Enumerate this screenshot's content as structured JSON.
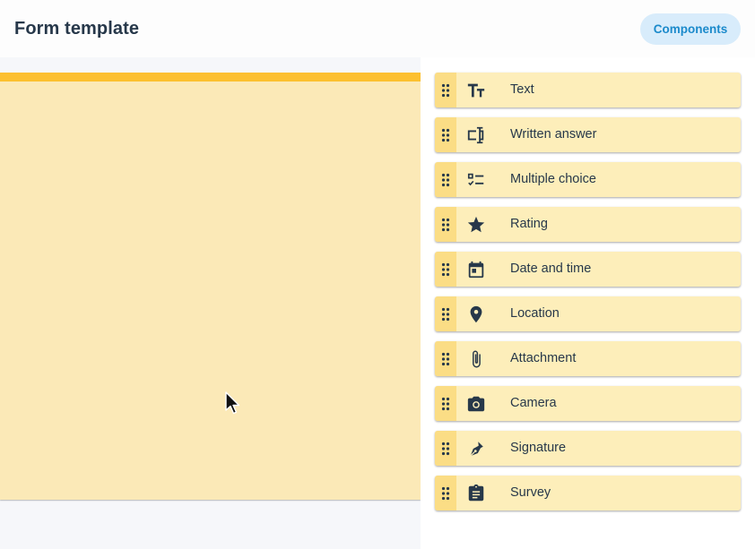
{
  "header": {
    "title": "Form template",
    "components_button": "Components"
  },
  "components": [
    {
      "label": "Text",
      "icon": "text-format-icon"
    },
    {
      "label": "Written answer",
      "icon": "text-input-icon"
    },
    {
      "label": "Multiple choice",
      "icon": "checklist-icon"
    },
    {
      "label": "Rating",
      "icon": "star-icon"
    },
    {
      "label": "Date and time",
      "icon": "calendar-icon"
    },
    {
      "label": "Location",
      "icon": "location-pin-icon"
    },
    {
      "label": "Attachment",
      "icon": "paperclip-icon"
    },
    {
      "label": "Camera",
      "icon": "camera-icon"
    },
    {
      "label": "Signature",
      "icon": "pen-nib-icon"
    },
    {
      "label": "Survey",
      "icon": "clipboard-icon"
    }
  ],
  "colors": {
    "accent": "#fcc02f",
    "card": "#fbe9b7",
    "component_bg": "#fdeeba",
    "handle_bg": "#fbdd85",
    "button_bg": "#d8ecfb",
    "button_text": "#1b8acb",
    "text": "#27384a"
  }
}
